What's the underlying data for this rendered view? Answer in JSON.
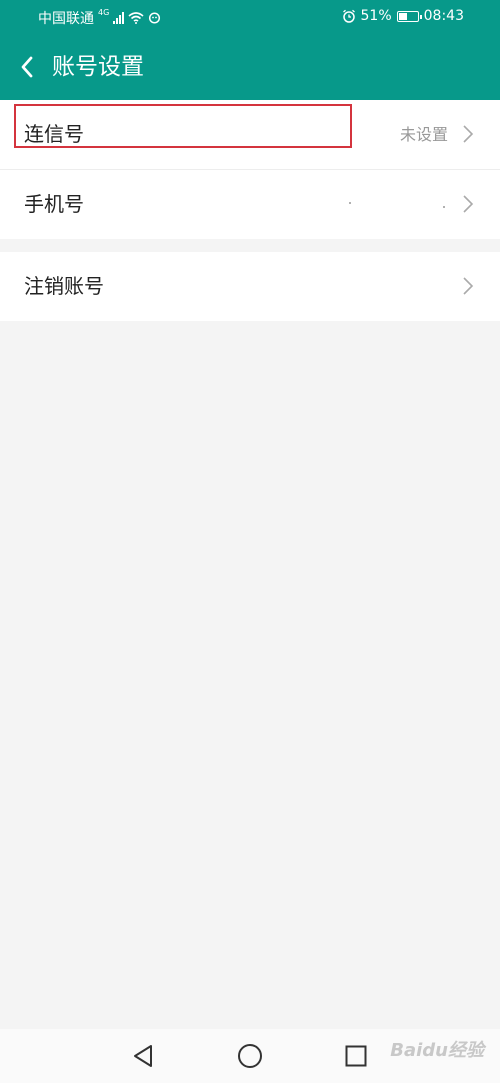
{
  "status_bar": {
    "carrier": "中国联通",
    "network": "4G",
    "battery_percent": "51%",
    "battery_level": 0.51,
    "time": "08:43"
  },
  "header": {
    "title": "账号设置"
  },
  "settings": {
    "items": [
      {
        "label": "连信号",
        "value": "未设置"
      },
      {
        "label": "手机号",
        "value": ""
      },
      {
        "label": "注销账号",
        "value": ""
      }
    ]
  },
  "watermark": "Baidu经验",
  "colors": {
    "header_bg": "#07998a",
    "highlight_border": "#d4343e",
    "page_bg": "#f4f4f4"
  },
  "icons": [
    "back-arrow-icon",
    "chevron-right-icon",
    "nav-back-icon",
    "nav-home-icon",
    "nav-recents-icon",
    "alarm-icon",
    "wifi-icon",
    "signal-icon",
    "battery-icon"
  ]
}
